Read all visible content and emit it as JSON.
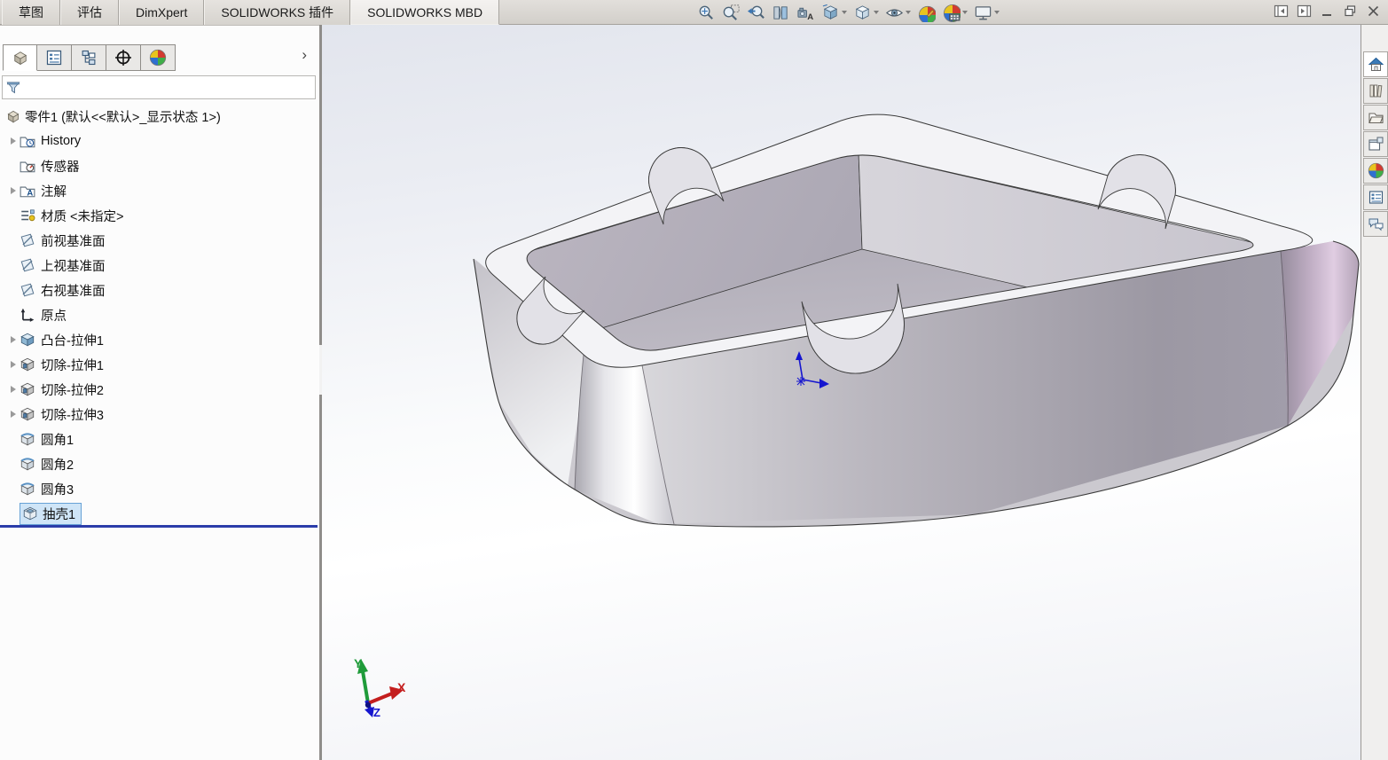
{
  "command_tabs": [
    {
      "label": "草图"
    },
    {
      "label": "评估"
    },
    {
      "label": "DimXpert"
    },
    {
      "label": "SOLIDWORKS 插件"
    },
    {
      "label": "SOLIDWORKS MBD"
    }
  ],
  "headsup_buttons": [
    {
      "name": "zoom-to-fit"
    },
    {
      "name": "zoom-to-area"
    },
    {
      "name": "previous-view"
    },
    {
      "name": "section-view"
    },
    {
      "name": "annotation-view"
    },
    {
      "name": "view-orientation",
      "dropdown": true
    },
    {
      "name": "display-style",
      "dropdown": true
    },
    {
      "name": "hide-show-items",
      "dropdown": true
    },
    {
      "name": "edit-appearance"
    },
    {
      "name": "apply-scene",
      "dropdown": true
    },
    {
      "name": "view-settings",
      "dropdown": true
    }
  ],
  "feature_panel": {
    "chevron": "›",
    "root_label": "零件1 (默认<<默认>_显示状态 1>)",
    "items": [
      {
        "label": "History",
        "icon": "history-folder",
        "expandable": true
      },
      {
        "label": "传感器",
        "icon": "sensors-folder",
        "expandable": false
      },
      {
        "label": "注解",
        "icon": "annotations-folder",
        "expandable": true
      },
      {
        "label": "材质 <未指定>",
        "icon": "material",
        "expandable": false
      },
      {
        "label": "前视基准面",
        "icon": "plane",
        "expandable": false
      },
      {
        "label": "上视基准面",
        "icon": "plane",
        "expandable": false
      },
      {
        "label": "右视基准面",
        "icon": "plane",
        "expandable": false
      },
      {
        "label": "原点",
        "icon": "origin",
        "expandable": false
      },
      {
        "label": "凸台-拉伸1",
        "icon": "boss-extrude",
        "expandable": true
      },
      {
        "label": "切除-拉伸1",
        "icon": "cut-extrude",
        "expandable": true
      },
      {
        "label": "切除-拉伸2",
        "icon": "cut-extrude",
        "expandable": true
      },
      {
        "label": "切除-拉伸3",
        "icon": "cut-extrude",
        "expandable": true
      },
      {
        "label": "圆角1",
        "icon": "fillet",
        "expandable": false
      },
      {
        "label": "圆角2",
        "icon": "fillet",
        "expandable": false
      },
      {
        "label": "圆角3",
        "icon": "fillet",
        "expandable": false
      },
      {
        "label": "抽壳1",
        "icon": "shell",
        "expandable": false,
        "selected": true
      }
    ]
  },
  "viewport": {
    "triad": {
      "x": "X",
      "y": "Y",
      "z": "Z"
    }
  },
  "task_pane_items": [
    {
      "name": "solidworks-resources"
    },
    {
      "name": "design-library"
    },
    {
      "name": "file-explorer"
    },
    {
      "name": "view-palette"
    },
    {
      "name": "appearances-scenes"
    },
    {
      "name": "custom-properties"
    },
    {
      "name": "solidworks-forum"
    }
  ],
  "colors": {
    "selection_fill": "#cfe5f7",
    "selection_border": "#68a2d6",
    "rollback_bar": "#2b3daa",
    "triad_x": "#c41e1e",
    "triad_y": "#1f9b3a",
    "triad_z": "#1515cf",
    "origin_marker": "#1515cf"
  }
}
